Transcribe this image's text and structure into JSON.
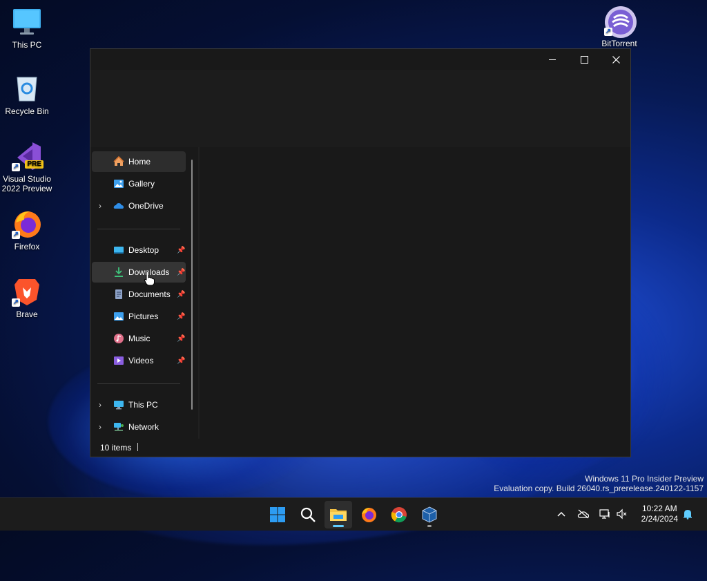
{
  "desktop": {
    "icons": [
      {
        "label": "This PC"
      },
      {
        "label": "Recycle Bin"
      },
      {
        "label": "Visual Studio 2022 Preview",
        "badge": "PRE"
      },
      {
        "label": "Firefox"
      },
      {
        "label": "Brave"
      },
      {
        "label": "BitTorrent"
      }
    ],
    "watermark": {
      "line1": "Windows 11 Pro Insider Preview",
      "line2": "Evaluation copy. Build 26040.rs_prerelease.240122-1157"
    }
  },
  "window": {
    "controls": {
      "minimize": "—",
      "maximize": "☐",
      "close": "✕"
    },
    "nav": {
      "items": [
        {
          "label": "Home",
          "icon": "home-icon",
          "selected": true
        },
        {
          "label": "Gallery",
          "icon": "gallery-icon"
        },
        {
          "label": "OneDrive",
          "icon": "onedrive-icon",
          "expandable": true
        },
        {
          "label": "Desktop",
          "icon": "desktop-folder-icon",
          "pinned": true
        },
        {
          "label": "Downloads",
          "icon": "downloads-icon",
          "pinned": true,
          "hover": true
        },
        {
          "label": "Documents",
          "icon": "documents-icon",
          "pinned": true
        },
        {
          "label": "Pictures",
          "icon": "pictures-icon",
          "pinned": true
        },
        {
          "label": "Music",
          "icon": "music-icon",
          "pinned": true
        },
        {
          "label": "Videos",
          "icon": "videos-icon",
          "pinned": true
        },
        {
          "label": "This PC",
          "icon": "this-pc-icon",
          "expandable": true
        },
        {
          "label": "Network",
          "icon": "network-icon",
          "expandable": true
        }
      ]
    },
    "status": {
      "items_count": "10 items"
    }
  },
  "taskbar": {
    "apps": [
      "start-icon",
      "search-icon",
      "file-explorer-icon",
      "firefox-icon",
      "chrome-icon",
      "virtualbox-icon"
    ],
    "clock": {
      "time": "10:22 AM",
      "date": "2/24/2024"
    }
  },
  "colors": {
    "window_bg": "#191919",
    "accent": "#60cdff",
    "folder_yellow": "#f4c244"
  }
}
